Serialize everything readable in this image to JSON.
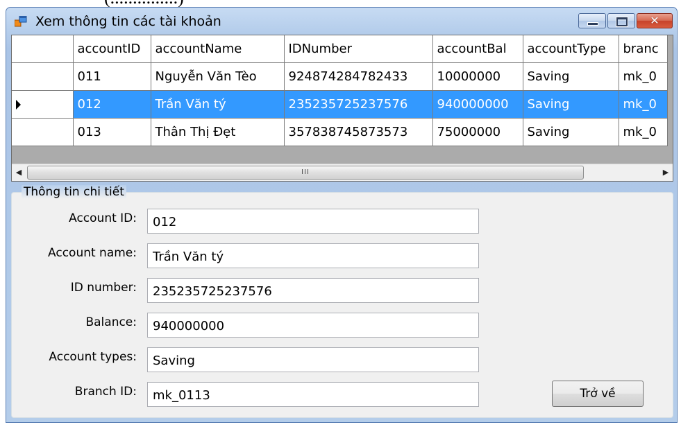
{
  "top_caption": "(...............)",
  "window": {
    "title": "Xem thông tin các tài khoản"
  },
  "grid": {
    "columns": [
      "accountID",
      "accountName",
      "IDNumber",
      "accountBal",
      "accountType",
      "branc"
    ],
    "rows": [
      {
        "cells": [
          "011",
          "Nguyễn Văn Tèo",
          "924874284782433",
          "10000000",
          "Saving",
          "mk_0"
        ],
        "selected": false
      },
      {
        "cells": [
          "012",
          "Trần Văn tý",
          "235235725237576",
          "940000000",
          "Saving",
          "mk_0"
        ],
        "selected": true
      },
      {
        "cells": [
          "013",
          "Thân Thị Đẹt",
          "357838745873573",
          "75000000",
          "Saving",
          "mk_0"
        ],
        "selected": false
      }
    ],
    "scrollbar_thumb_label": "III"
  },
  "details": {
    "legend": "Thông tin chi tiết",
    "account_id_label": "Account ID:",
    "account_id_value": "012",
    "account_name_label": "Account name:",
    "account_name_value": "Trần Văn tý",
    "id_number_label": "ID number:",
    "id_number_value": "235235725237576",
    "balance_label": "Balance:",
    "balance_value": "940000000",
    "account_types_label": "Account types:",
    "account_types_value": "Saving",
    "branch_id_label": "Branch ID:",
    "branch_id_value": "mk_0113"
  },
  "buttons": {
    "back_label": "Trở về"
  }
}
